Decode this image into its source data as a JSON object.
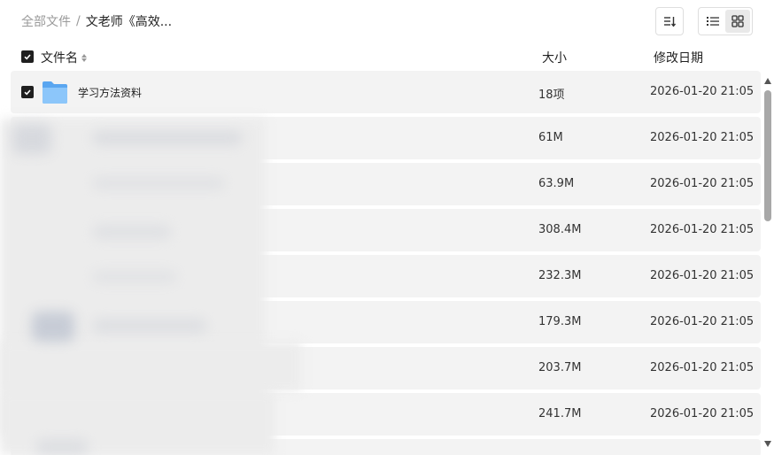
{
  "breadcrumb": {
    "root": "全部文件",
    "separator": "/",
    "current": "文老师《高效..."
  },
  "toolbar": {
    "sort_icon": "sort-icon",
    "list_view_icon": "list-view-icon",
    "grid_view_icon": "grid-view-icon"
  },
  "table": {
    "headers": {
      "name": "文件名",
      "size": "大小",
      "date": "修改日期"
    },
    "rows": [
      {
        "name": "学习方法资料",
        "size": "18项",
        "date": "2026-01-20 21:05",
        "type": "folder",
        "checked": true
      },
      {
        "name": "",
        "size": "61M",
        "date": "2026-01-20 21:05",
        "type": "file"
      },
      {
        "name": "",
        "size": "63.9M",
        "date": "2026-01-20 21:05",
        "type": "file"
      },
      {
        "name": "",
        "size": "308.4M",
        "date": "2026-01-20 21:05",
        "type": "file"
      },
      {
        "name": "",
        "size": "232.3M",
        "date": "2026-01-20 21:05",
        "type": "file"
      },
      {
        "name": "",
        "size": "179.3M",
        "date": "2026-01-20 21:05",
        "type": "file"
      },
      {
        "name": "",
        "size": "203.7M",
        "date": "2026-01-20 21:05",
        "type": "file"
      },
      {
        "name": "",
        "size": "241.7M",
        "date": "2026-01-20 21:05",
        "type": "file"
      }
    ]
  },
  "colors": {
    "row_bg": "#f3f3f3",
    "folder": "#6fb3f5",
    "checkbox": "#1f1f1f",
    "muted_text": "#9a9a9a"
  }
}
